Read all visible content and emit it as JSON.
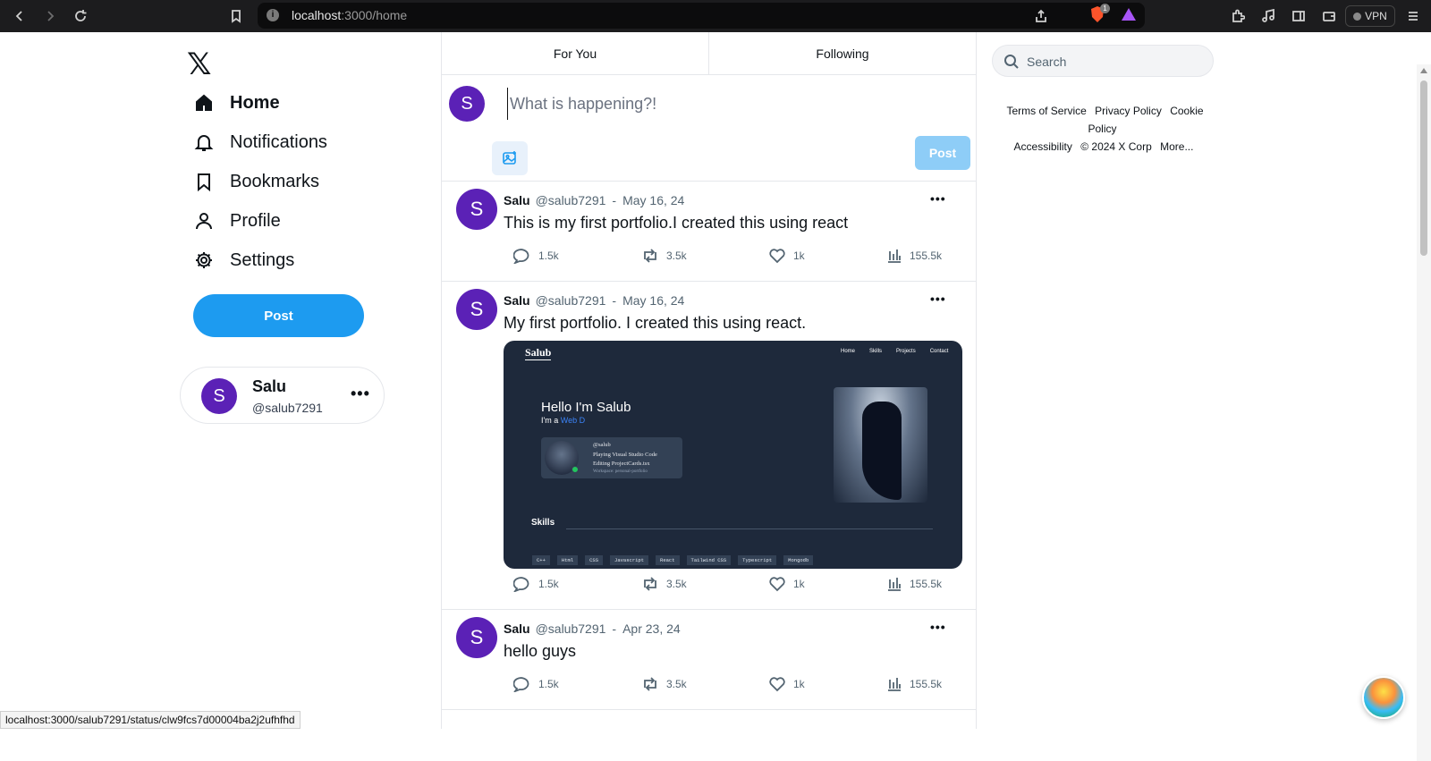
{
  "browser": {
    "url_host": "localhost",
    "url_path": ":3000/home",
    "shield_badge": "1",
    "vpn_label": "VPN"
  },
  "logo": "𝕏",
  "sidebar": {
    "items": [
      {
        "label": "Home",
        "icon": "home-icon"
      },
      {
        "label": "Notifications",
        "icon": "bell-icon"
      },
      {
        "label": "Bookmarks",
        "icon": "bookmark-icon"
      },
      {
        "label": "Profile",
        "icon": "user-icon"
      },
      {
        "label": "Settings",
        "icon": "gear-icon"
      }
    ],
    "post_label": "Post",
    "user": {
      "initial": "S",
      "name": "Salu",
      "handle": "@salub7291",
      "more": "•••"
    }
  },
  "tabs": [
    "For You",
    "Following"
  ],
  "composer": {
    "initial": "S",
    "placeholder": "What is happening?!",
    "post_label": "Post"
  },
  "tweets": [
    {
      "initial": "S",
      "name": "Salu",
      "handle": "@salub7291",
      "sep": "-",
      "date": "May 16, 24",
      "text": "This is my first portfolio.I created this using react",
      "comments": "1.5k",
      "retweets": "3.5k",
      "likes": "1k",
      "views": "155.5k"
    },
    {
      "initial": "S",
      "name": "Salu",
      "handle": "@salub7291",
      "sep": "-",
      "date": "May 16, 24",
      "text": "My first portfolio. I created this using react.",
      "comments": "1.5k",
      "retweets": "3.5k",
      "likes": "1k",
      "views": "155.5k",
      "image": {
        "brand": "Salub",
        "nav": [
          "Home",
          "Skills",
          "Projects",
          "Contact"
        ],
        "hello": "Hello I'm Salub",
        "ima_prefix": "I'm a",
        "ima_role": "Web D",
        "discord": [
          "@salub",
          "Playing Visual Studio Code",
          "Editing ProjectCards.tsx",
          "Workspace: personal-portfolio"
        ],
        "skills_title": "Skills",
        "skills": [
          "C++",
          "Html",
          "CSS",
          "Javascript",
          "React",
          "Tailwind CSS",
          "Typescript",
          "Mongodb"
        ]
      }
    },
    {
      "initial": "S",
      "name": "Salu",
      "handle": "@salub7291",
      "sep": "-",
      "date": "Apr 23, 24",
      "text": "hello guys",
      "comments": "1.5k",
      "retweets": "3.5k",
      "likes": "1k",
      "views": "155.5k"
    }
  ],
  "right": {
    "search_placeholder": "Search",
    "footer_row1": [
      "Terms of Service",
      "Privacy Policy",
      "Cookie Policy"
    ],
    "footer_row2": [
      "Accessibility",
      "© 2024 X Corp",
      "More..."
    ]
  },
  "status_url": "localhost:3000/salub7291/status/clw9fcs7d00004ba2j2ufhfhd"
}
